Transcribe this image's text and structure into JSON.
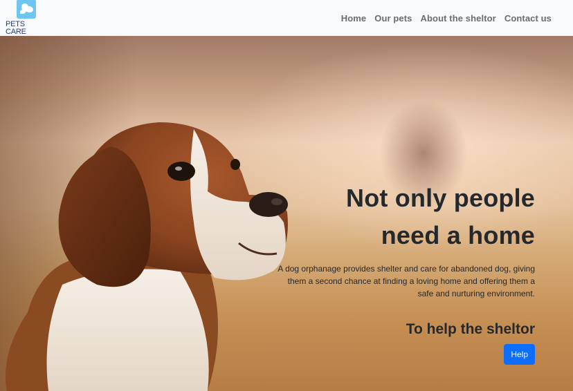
{
  "brand": {
    "name": "PETS CARE",
    "logo_icon": "paw-icon"
  },
  "nav": {
    "items": [
      {
        "label": "Home"
      },
      {
        "label": "Our pets"
      },
      {
        "label": "About the sheltor"
      },
      {
        "label": "Contact us"
      }
    ]
  },
  "hero": {
    "title_line1": "Not only people",
    "title_line2": "need a home",
    "description": "A dog orphanage provides shelter and care for abandoned dog, giving them a second chance at finding a loving home and offering them a safe and nurturing environment.",
    "cta_title": "To help the sheltor",
    "cta_button": "Help"
  },
  "colors": {
    "primary": "#0d6efd",
    "navbar_bg": "#f8f9fa",
    "brand_text": "#2a3a7a",
    "logo_bg": "#6ec6f0"
  }
}
